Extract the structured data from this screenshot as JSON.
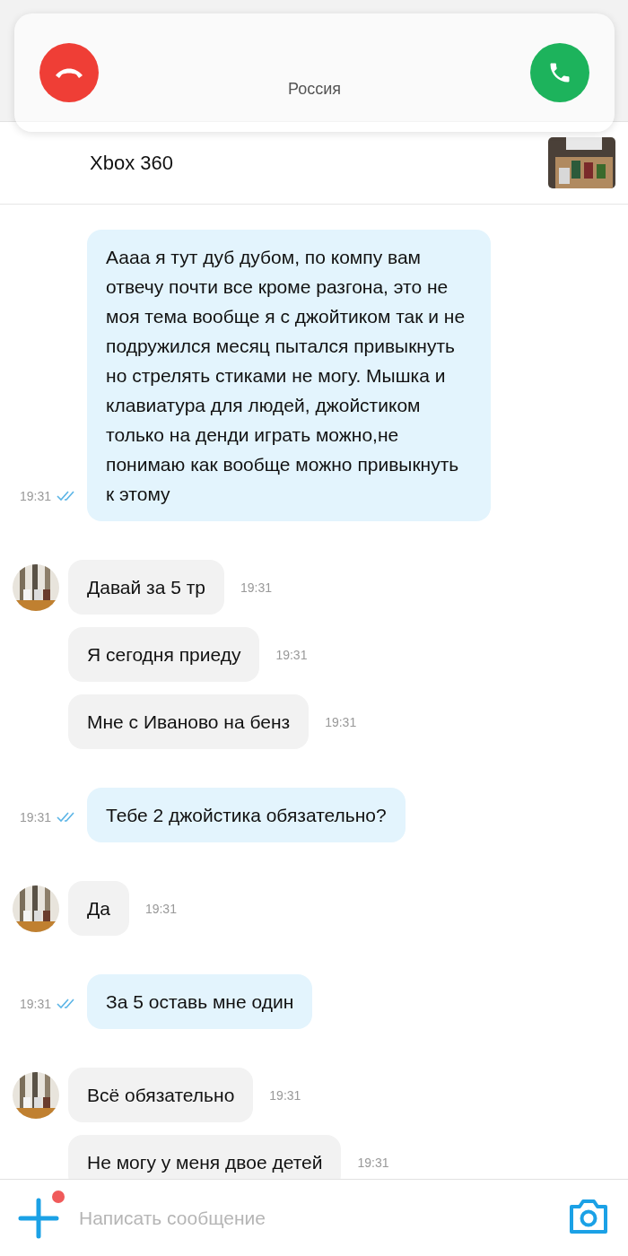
{
  "call_banner": {
    "subtitle": "Россия"
  },
  "listing": {
    "title": "Xbox 360"
  },
  "messages": [
    {
      "kind": "outgoing",
      "text": "Аааа я тут дуб дубом, по компу вам отвечу почти все кроме разгона, это не моя тема вообще я с джойтиком так и не подружился месяц пытался привыкнуть но стрелять стиками не могу. Мышка и клавиатура для людей, джойстиком только на денди играть можно,не понимаю как вообще можно привыкнуть к этому",
      "time": "19:31",
      "read": true
    },
    {
      "kind": "incoming",
      "text": "Давай за 5 тр",
      "time": "19:31",
      "avatar": true
    },
    {
      "kind": "incoming",
      "text": "Я сегодня приеду",
      "time": "19:31",
      "avatar": false
    },
    {
      "kind": "incoming",
      "text": "Мне с Иваново на бенз",
      "time": "19:31",
      "avatar": false
    },
    {
      "kind": "outgoing",
      "text": "Тебе 2 джойстика обязательно?",
      "time": "19:31",
      "read": true
    },
    {
      "kind": "incoming",
      "text": "Да",
      "time": "19:31",
      "avatar": true
    },
    {
      "kind": "outgoing",
      "text": "За 5 оставь мне один",
      "time": "19:31",
      "read": true
    },
    {
      "kind": "incoming",
      "text": "Всё обязательно",
      "time": "19:31",
      "avatar": true
    },
    {
      "kind": "incoming",
      "text": "Не могу у меня двое детей",
      "time": "19:31",
      "avatar": false
    }
  ],
  "composer": {
    "placeholder": "Написать сообщение",
    "attach_badge": true
  }
}
